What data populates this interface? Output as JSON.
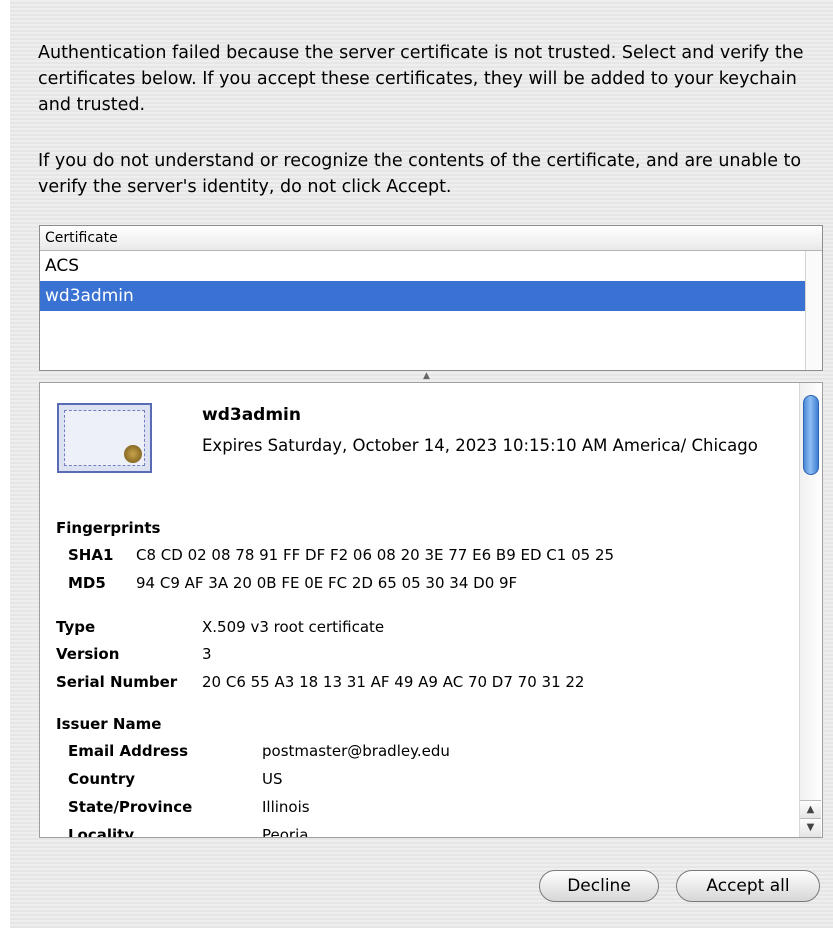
{
  "message": {
    "paragraph1": "Authentication failed because the server certificate is not trusted.  Select and verify the certificates below. If you accept these certificates, they will be added to your keychain and trusted.",
    "paragraph2": "If you do not understand or recognize the contents of the certificate, and are unable to verify the server's identity, do not click Accept."
  },
  "certificate_list": {
    "header": "Certificate",
    "items": [
      {
        "label": "ACS",
        "selected": false
      },
      {
        "label": "wd3admin",
        "selected": true
      }
    ]
  },
  "details": {
    "name": "wd3admin",
    "expires": "Expires Saturday, October 14, 2023 10:15:10 AM America/ Chicago",
    "fingerprints_heading": "Fingerprints",
    "sha1_label": "SHA1",
    "sha1_value": "C8 CD 02 08 78 91 FF DF F2 06 08 20 3E 77 E6 B9 ED C1 05 25",
    "md5_label": "MD5",
    "md5_value": "94 C9 AF 3A 20 0B FE 0E FC 2D 65 05 30 34 D0 9F",
    "type_label": "Type",
    "type_value": "X.509 v3 root certificate",
    "version_label": "Version",
    "version_value": "3",
    "serial_label": "Serial Number",
    "serial_value": "20 C6 55 A3 18 13 31 AF 49 A9 AC 70 D7 70 31 22",
    "issuer_heading": "Issuer Name",
    "issuer_fields": [
      {
        "label": "Email Address",
        "value": "postmaster@bradley.edu"
      },
      {
        "label": "Country",
        "value": "US"
      },
      {
        "label": "State/Province",
        "value": "Illinois"
      },
      {
        "label": "Locality",
        "value": "Peoria"
      }
    ]
  },
  "buttons": {
    "decline": "Decline",
    "accept_all": "Accept all"
  },
  "colors": {
    "selection": "#3a72d3",
    "scroll_thumb": "#4d8ad8"
  }
}
